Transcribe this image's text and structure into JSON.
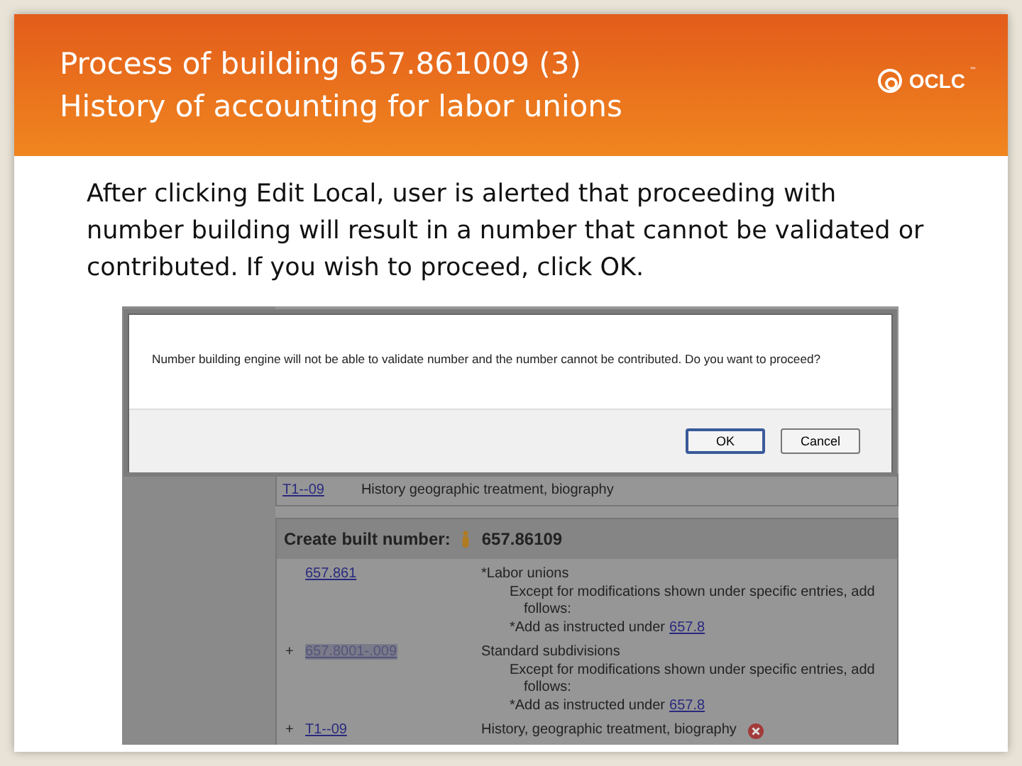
{
  "header": {
    "title_lines": [
      "Process of building 657.861009 (3)",
      "History of accounting for labor unions"
    ],
    "logo": "OCLC",
    "logo_mark": "™"
  },
  "body_text": "After clicking Edit Local, user is alerted that proceeding with number building will result in a number that cannot be validated or contributed.  If you wish to proceed, click OK.",
  "screenshot": {
    "dialog": {
      "message": "Number building engine will not be able to validate number and the number cannot be contributed. Do you want to proceed?",
      "buttons": [
        {
          "label": "OK",
          "selected": true
        },
        {
          "label": "Cancel",
          "selected": false
        }
      ]
    },
    "prior_row": {
      "number": "T1--09",
      "caption": "History geographic treatment, biography"
    },
    "built_number": {
      "label": "Create built number:",
      "value": "657.86109"
    },
    "rows": [
      {
        "expander": "",
        "number": "657.861",
        "selected": false,
        "removable": false,
        "lines": [
          {
            "kind": "heading",
            "text": "*Labor unions"
          },
          {
            "kind": "note",
            "text": "Except for modifications shown under specific entries, add"
          },
          {
            "kind": "continued",
            "text": "follows:"
          },
          {
            "kind": "instruction",
            "text": "*Add as instructed under",
            "link": "657.8"
          }
        ]
      },
      {
        "expander": "+",
        "number": "657.8001-.009",
        "selected": true,
        "removable": false,
        "lines": [
          {
            "kind": "heading",
            "text": "Standard subdivisions"
          },
          {
            "kind": "note",
            "text": "Except for modifications shown under specific entries, add"
          },
          {
            "kind": "continued",
            "text": "follows:"
          },
          {
            "kind": "instruction",
            "text": "*Add as instructed under",
            "link": "657.8"
          }
        ]
      },
      {
        "expander": "+",
        "number": "T1--09",
        "selected": false,
        "removable": true,
        "lines": [
          {
            "kind": "heading",
            "text": "History, geographic treatment, biography"
          }
        ]
      }
    ]
  }
}
